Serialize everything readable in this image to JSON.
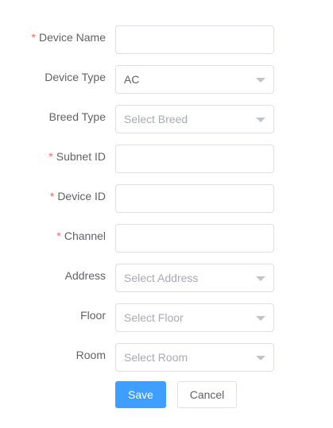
{
  "form": {
    "device_name": {
      "label": "Device Name",
      "required": true,
      "value": ""
    },
    "device_type": {
      "label": "Device Type",
      "value": "AC"
    },
    "breed_type": {
      "label": "Breed Type",
      "placeholder": "Select Breed"
    },
    "subnet_id": {
      "label": "Subnet ID",
      "required": true,
      "value": ""
    },
    "device_id": {
      "label": "Device ID",
      "required": true,
      "value": ""
    },
    "channel": {
      "label": "Channel",
      "required": true,
      "value": ""
    },
    "address": {
      "label": "Address",
      "placeholder": "Select Address"
    },
    "floor": {
      "label": "Floor",
      "placeholder": "Select Floor"
    },
    "room": {
      "label": "Room",
      "placeholder": "Select Room"
    }
  },
  "required_mark": "*",
  "buttons": {
    "save_label": "Save",
    "cancel_label": "Cancel"
  },
  "colors": {
    "primary": "#409eff",
    "required": "#f56c6c",
    "border": "#dcdfe6",
    "placeholder": "#a8abb2",
    "text": "#606266"
  },
  "icons": {
    "select_caret": "chevron-down-icon"
  }
}
